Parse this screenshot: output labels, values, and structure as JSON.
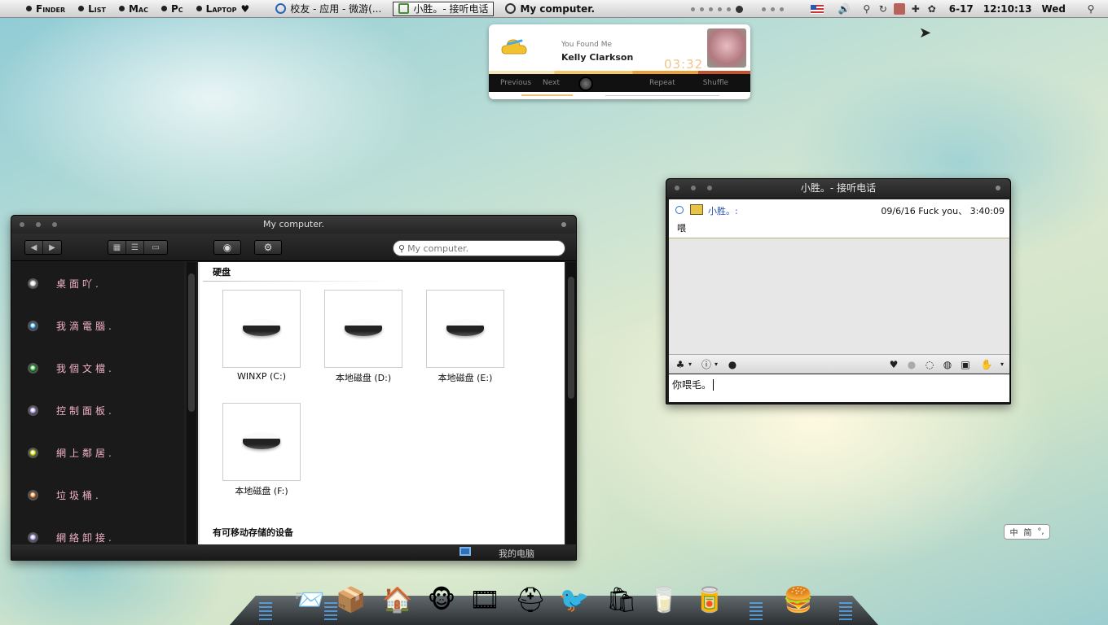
{
  "menubar": {
    "apple": "",
    "items": [
      "Finder",
      "List",
      "Mac",
      "Pc",
      "Laptop"
    ],
    "heart": "♥",
    "tasks": [
      {
        "label": "校友 - 应用 - 微游(..."
      },
      {
        "label": "小胜。- 接听电话"
      },
      {
        "label": "My computer."
      }
    ],
    "date": "6-17",
    "time": "12:10:13",
    "day": "Wed"
  },
  "music": {
    "found_label": "You Found Me",
    "artist": "Kelly Clarkson",
    "elapsed": "03:32",
    "controls": [
      "Previous",
      "Next",
      "Repeat",
      "Shuffle"
    ],
    "volume": 0.45
  },
  "finder": {
    "title": "My computer.",
    "search_placeholder": "My computer.",
    "sidebar": [
      {
        "label": "桌面吖.",
        "color": "#e6e6e6"
      },
      {
        "label": "我滴電腦.",
        "color": "#3aa0e6"
      },
      {
        "label": "我個文檔.",
        "color": "#2bbf3a"
      },
      {
        "label": "控制面板.",
        "color": "#b9a6f0"
      },
      {
        "label": "網上鄰居.",
        "color": "#d6e020"
      },
      {
        "label": "垃圾桶.",
        "color": "#e07a2a"
      },
      {
        "label": "網絡卸接.",
        "color": "#b9a6f0"
      }
    ],
    "section_hdd": "硬盘",
    "drives": [
      {
        "label": "WINXP (C:)"
      },
      {
        "label": "本地磁盘 (D:)"
      },
      {
        "label": "本地磁盘 (E:)"
      },
      {
        "label": "本地磁盘 (F:)"
      }
    ],
    "section_removable": "有可移动存储的设备",
    "status": "我的电脑"
  },
  "chat": {
    "title": "小胜。- 接听电话",
    "nick": "小胜。:",
    "timestamp": "09/6/16 Fuck you、 3:40:09",
    "message": "喂",
    "input_value": "你喂毛。"
  },
  "ime": {
    "labels": [
      "中",
      "简",
      "°,"
    ]
  }
}
